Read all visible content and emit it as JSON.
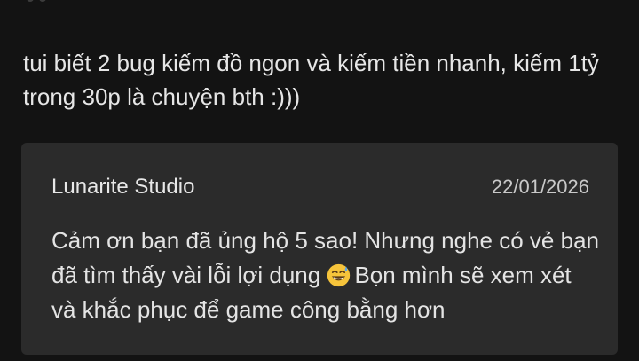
{
  "review": {
    "text": "tui biết 2 bug kiếm đồ ngon và kiếm tiền nhanh, kiếm 1tỷ trong 30p là chuyện bth :)))"
  },
  "reply": {
    "author": "Lunarite Studio",
    "date": "22/01/2026",
    "text_before_emoji": "Cảm ơn bạn đã ủng hộ 5 sao! Nhưng nghe có vẻ bạn đã tìm thấy vài lỗi lợi dụng ",
    "emoji": "grinning-sweat-emoji",
    "text_after_emoji": "Bọn mình sẽ xem xét và khắc phục để game công bằng hơn"
  },
  "colors": {
    "background": "#131313",
    "card": "#2b2b2b",
    "text": "#e4e4e4"
  }
}
